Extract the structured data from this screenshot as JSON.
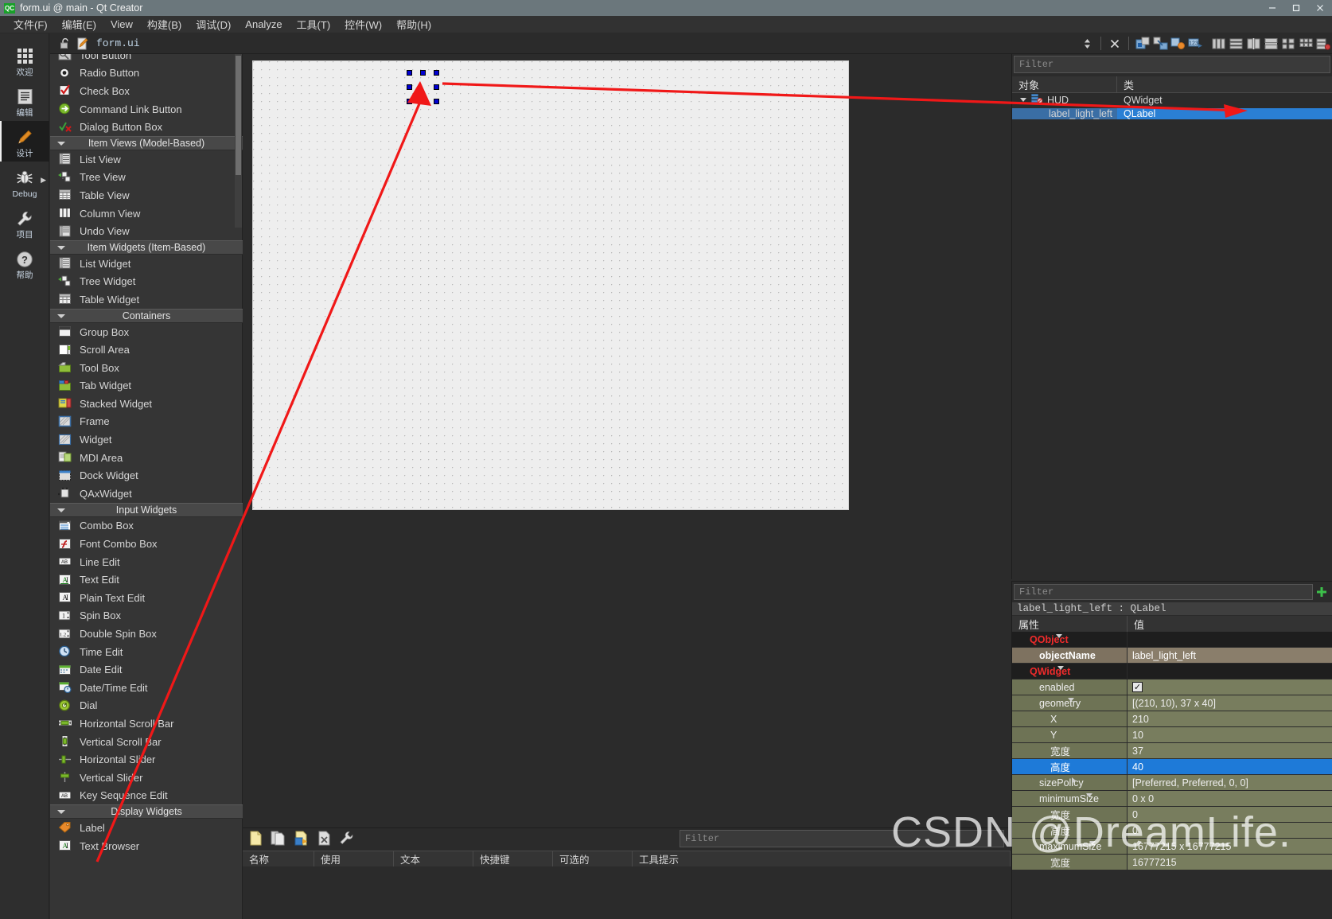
{
  "window": {
    "title": "form.ui @ main - Qt Creator",
    "app_badge": "QC",
    "controls": {
      "minimize": "minimize-button",
      "maximize": "maximize-button",
      "close": "close-button"
    }
  },
  "menubar": {
    "items": [
      {
        "label": "文件(F)",
        "accel": "F"
      },
      {
        "label": "编辑(E)",
        "accel": "E"
      },
      {
        "label": "View",
        "accel": "V"
      },
      {
        "label": "构建(B)",
        "accel": "B"
      },
      {
        "label": "调试(D)",
        "accel": "D"
      },
      {
        "label": "Analyze",
        "accel": "A"
      },
      {
        "label": "工具(T)",
        "accel": "T"
      },
      {
        "label": "控件(W)",
        "accel": "W"
      },
      {
        "label": "帮助(H)",
        "accel": "H"
      }
    ]
  },
  "modebar": {
    "items": [
      {
        "label": "欢迎",
        "icon": "grid-dots-icon",
        "active": false
      },
      {
        "label": "编辑",
        "icon": "document-lines-icon",
        "active": false
      },
      {
        "label": "设计",
        "icon": "pencil-icon",
        "active": true
      },
      {
        "label": "Debug",
        "icon": "bug-icon",
        "active": false,
        "has_arrow": true
      },
      {
        "label": "项目",
        "icon": "wrench-icon",
        "active": false
      },
      {
        "label": "帮助",
        "icon": "question-mark-icon",
        "active": false
      }
    ]
  },
  "designer_toolbar": {
    "lock_icon": "unlocked-padlock-icon",
    "file_icon": "edit-document-icon",
    "filename": "form.ui",
    "stepper_icon": "updown-stepper-icon",
    "close_icon": "close-x-icon",
    "buttons": [
      {
        "name": "edit-widgets-button",
        "icon": "edit-widgets-icon"
      },
      {
        "name": "edit-signals-slots-button",
        "icon": "signals-slots-icon"
      },
      {
        "name": "edit-buddies-button",
        "icon": "buddies-icon"
      },
      {
        "name": "edit-tab-order-button",
        "icon": "tab-order-icon"
      },
      {
        "name": "layout-horizontally-button",
        "icon": "layout-horizontal-icon"
      },
      {
        "name": "layout-vertically-button",
        "icon": "layout-vertical-icon"
      },
      {
        "name": "layout-splitter-horizontal-button",
        "icon": "splitter-horizontal-icon"
      },
      {
        "name": "layout-splitter-vertical-button",
        "icon": "splitter-vertical-icon"
      },
      {
        "name": "layout-in-form-button",
        "icon": "form-layout-icon"
      },
      {
        "name": "layout-in-grid-button",
        "icon": "grid-layout-icon"
      },
      {
        "name": "break-layout-button",
        "icon": "break-layout-icon"
      }
    ]
  },
  "widgetbox": {
    "filter_placeholder": "Filter",
    "rows": [
      {
        "type": "item",
        "label": "Tool Button",
        "icon": "tool-button-icon",
        "clipped": true
      },
      {
        "type": "item",
        "label": "Radio Button",
        "icon": "radio-button-icon"
      },
      {
        "type": "item",
        "label": "Check Box",
        "icon": "check-box-icon"
      },
      {
        "type": "item",
        "label": "Command Link Button",
        "icon": "command-link-button-icon"
      },
      {
        "type": "item",
        "label": "Dialog Button Box",
        "icon": "dialog-button-box-icon"
      },
      {
        "type": "group",
        "label": "Item Views (Model-Based)"
      },
      {
        "type": "item",
        "label": "List View",
        "icon": "list-view-icon"
      },
      {
        "type": "item",
        "label": "Tree View",
        "icon": "tree-view-icon"
      },
      {
        "type": "item",
        "label": "Table View",
        "icon": "table-view-icon"
      },
      {
        "type": "item",
        "label": "Column View",
        "icon": "column-view-icon"
      },
      {
        "type": "item",
        "label": "Undo View",
        "icon": "undo-view-icon"
      },
      {
        "type": "group",
        "label": "Item Widgets (Item-Based)"
      },
      {
        "type": "item",
        "label": "List Widget",
        "icon": "list-widget-icon"
      },
      {
        "type": "item",
        "label": "Tree Widget",
        "icon": "tree-widget-icon"
      },
      {
        "type": "item",
        "label": "Table Widget",
        "icon": "table-widget-icon"
      },
      {
        "type": "group",
        "label": "Containers"
      },
      {
        "type": "item",
        "label": "Group Box",
        "icon": "group-box-icon"
      },
      {
        "type": "item",
        "label": "Scroll Area",
        "icon": "scroll-area-icon"
      },
      {
        "type": "item",
        "label": "Tool Box",
        "icon": "tool-box-icon"
      },
      {
        "type": "item",
        "label": "Tab Widget",
        "icon": "tab-widget-icon"
      },
      {
        "type": "item",
        "label": "Stacked Widget",
        "icon": "stacked-widget-icon"
      },
      {
        "type": "item",
        "label": "Frame",
        "icon": "frame-icon"
      },
      {
        "type": "item",
        "label": "Widget",
        "icon": "widget-icon"
      },
      {
        "type": "item",
        "label": "MDI Area",
        "icon": "mdi-area-icon"
      },
      {
        "type": "item",
        "label": "Dock Widget",
        "icon": "dock-widget-icon"
      },
      {
        "type": "item",
        "label": "QAxWidget",
        "icon": "qax-widget-icon"
      },
      {
        "type": "group",
        "label": "Input Widgets"
      },
      {
        "type": "item",
        "label": "Combo Box",
        "icon": "combo-box-icon"
      },
      {
        "type": "item",
        "label": "Font Combo Box",
        "icon": "font-combo-box-icon"
      },
      {
        "type": "item",
        "label": "Line Edit",
        "icon": "line-edit-icon"
      },
      {
        "type": "item",
        "label": "Text Edit",
        "icon": "text-edit-icon"
      },
      {
        "type": "item",
        "label": "Plain Text Edit",
        "icon": "plain-text-edit-icon"
      },
      {
        "type": "item",
        "label": "Spin Box",
        "icon": "spin-box-icon"
      },
      {
        "type": "item",
        "label": "Double Spin Box",
        "icon": "double-spin-box-icon"
      },
      {
        "type": "item",
        "label": "Time Edit",
        "icon": "time-edit-icon"
      },
      {
        "type": "item",
        "label": "Date Edit",
        "icon": "date-edit-icon"
      },
      {
        "type": "item",
        "label": "Date/Time Edit",
        "icon": "date-time-edit-icon"
      },
      {
        "type": "item",
        "label": "Dial",
        "icon": "dial-icon"
      },
      {
        "type": "item",
        "label": "Horizontal Scroll Bar",
        "icon": "horizontal-scroll-bar-icon"
      },
      {
        "type": "item",
        "label": "Vertical Scroll Bar",
        "icon": "vertical-scroll-bar-icon"
      },
      {
        "type": "item",
        "label": "Horizontal Slider",
        "icon": "horizontal-slider-icon"
      },
      {
        "type": "item",
        "label": "Vertical Slider",
        "icon": "vertical-slider-icon"
      },
      {
        "type": "item",
        "label": "Key Sequence Edit",
        "icon": "key-sequence-edit-icon"
      },
      {
        "type": "group",
        "label": "Display Widgets"
      },
      {
        "type": "item",
        "label": "Label",
        "icon": "label-icon"
      },
      {
        "type": "item",
        "label": "Text Browser",
        "icon": "text-browser-icon"
      }
    ]
  },
  "object_inspector": {
    "filter_placeholder": "Filter",
    "columns": [
      "对象",
      "类"
    ],
    "rows": [
      {
        "object": "HUD",
        "class": "QWidget",
        "level": 0,
        "expanded": true,
        "selected": false,
        "icon": "qwidget-icon"
      },
      {
        "object": "label_light_left",
        "class": "QLabel",
        "level": 1,
        "expanded": false,
        "selected": true,
        "icon": "qlabel-icon"
      }
    ]
  },
  "property_editor": {
    "filter_placeholder": "Filter",
    "add_button": "add-dynamic-property-button",
    "object_line": "label_light_left : QLabel",
    "columns": [
      "属性",
      "值"
    ],
    "rows": [
      {
        "name": "QObject",
        "value": "",
        "style": "grp",
        "indent": 0,
        "tri": "down"
      },
      {
        "name": "objectName",
        "value": "label_light_left",
        "style": "alt1",
        "indent": 1,
        "tri": ""
      },
      {
        "name": "QWidget",
        "value": "",
        "style": "grp",
        "indent": 0,
        "tri": "down"
      },
      {
        "name": "enabled",
        "value": "✓",
        "style": "alt2",
        "indent": 1,
        "tri": "",
        "checkbox": true
      },
      {
        "name": "geometry",
        "value": "[(210, 10), 37 x 40]",
        "style": "alt2",
        "indent": 1,
        "tri": "down"
      },
      {
        "name": "X",
        "value": "210",
        "style": "alt2",
        "indent": 2,
        "tri": ""
      },
      {
        "name": "Y",
        "value": "10",
        "style": "alt2",
        "indent": 2,
        "tri": ""
      },
      {
        "name": "宽度",
        "value": "37",
        "style": "alt2",
        "indent": 2,
        "tri": ""
      },
      {
        "name": "高度",
        "value": "40",
        "style": "sel",
        "indent": 2,
        "tri": ""
      },
      {
        "name": "sizePolicy",
        "value": "[Preferred, Preferred, 0, 0]",
        "style": "alt2",
        "indent": 1,
        "tri": "right"
      },
      {
        "name": "minimumSize",
        "value": "0 x 0",
        "style": "alt2",
        "indent": 1,
        "tri": "down"
      },
      {
        "name": "宽度",
        "value": "0",
        "style": "alt2",
        "indent": 2,
        "tri": ""
      },
      {
        "name": "高度",
        "value": "0",
        "style": "alt2",
        "indent": 2,
        "tri": ""
      },
      {
        "name": "maximumSize",
        "value": "16777215 x 16777215",
        "style": "alt2",
        "indent": 1,
        "tri": "down"
      },
      {
        "name": "宽度",
        "value": "16777215",
        "style": "alt2",
        "indent": 2,
        "tri": ""
      }
    ]
  },
  "action_editor": {
    "filter_placeholder": "Filter",
    "toolbar_buttons": [
      {
        "name": "new-action-button",
        "icon": "new-document-icon"
      },
      {
        "name": "copy-action-button",
        "icon": "copy-document-icon"
      },
      {
        "name": "paste-action-button",
        "icon": "paste-document-icon"
      },
      {
        "name": "delete-action-button",
        "icon": "delete-document-icon"
      },
      {
        "name": "configure-button",
        "icon": "wrench-icon"
      }
    ],
    "columns": [
      "名称",
      "使用",
      "文本",
      "快捷键",
      "可选的",
      "工具提示"
    ]
  },
  "canvas": {
    "form_name": "form-design-canvas",
    "selection_handles": 8,
    "selected_widget": "label_light_left"
  },
  "annotations": {
    "arrow_to_object_tree": "red-arrow-pointing-to-object-tree-row",
    "arrow_to_canvas_widget": "red-arrow-pointing-to-selected-widget"
  },
  "watermark": {
    "text": "CSDN @DreamLife."
  },
  "colors": {
    "accent_blue": "#1e7ad8",
    "selection_blue": "#2a7fd4",
    "annotation_red": "#f01818",
    "titlebar": "#6b777c",
    "group_red": "#ef2b2b"
  }
}
